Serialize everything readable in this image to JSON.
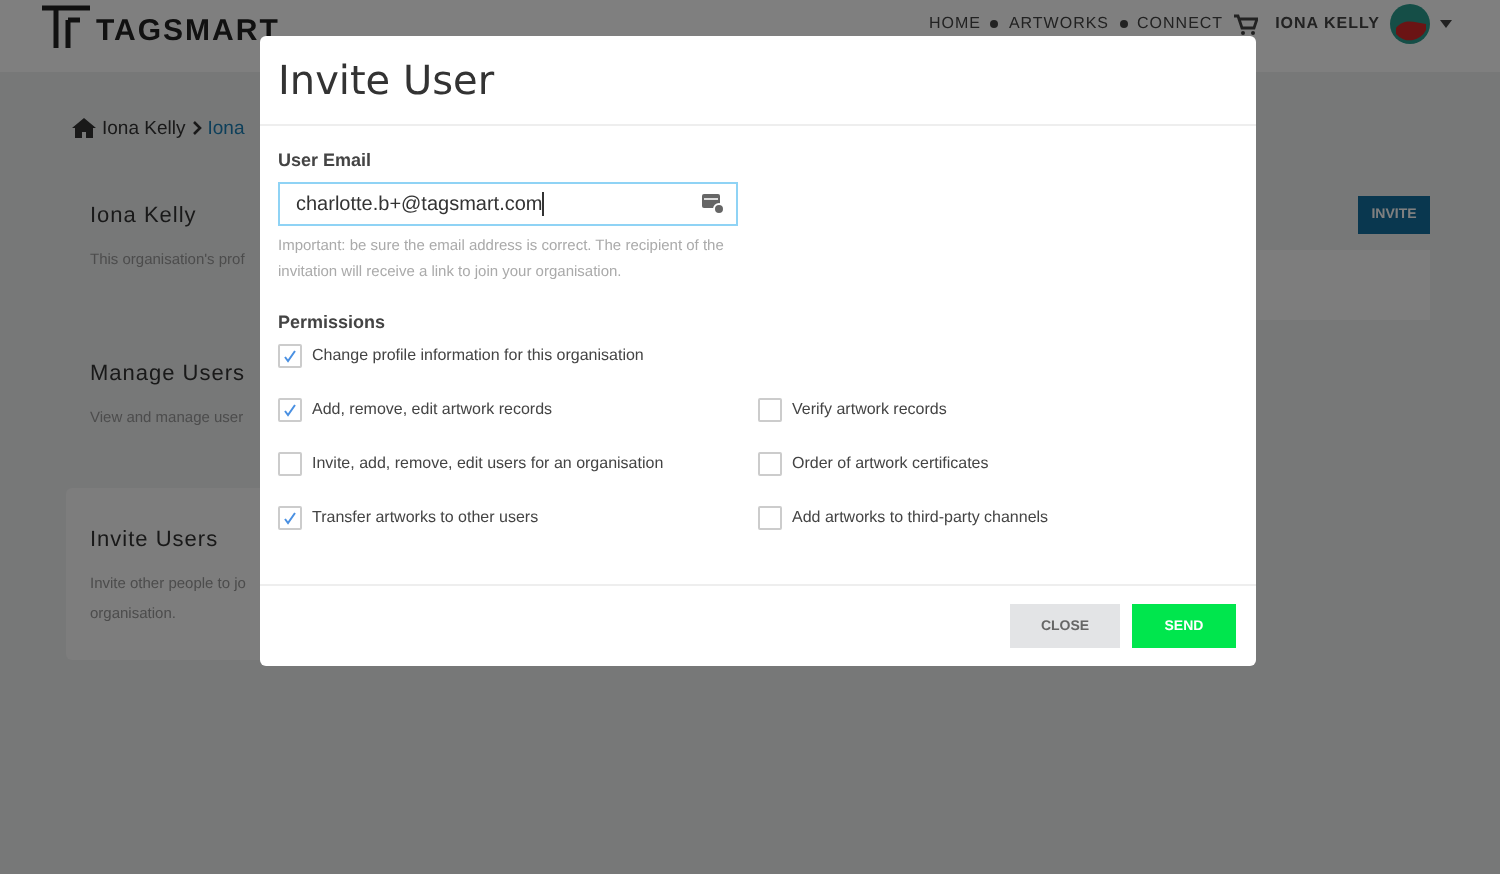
{
  "header": {
    "logo": "TAGSMART",
    "nav": [
      "HOME",
      "ARTWORKS",
      "CONNECT"
    ],
    "user": "IONA KELLY"
  },
  "breadcrumb": [
    "Iona Kelly",
    "Iona"
  ],
  "sections": [
    {
      "title": "Iona Kelly",
      "description": [
        "This organisation's prof"
      ],
      "selected": false
    },
    {
      "title": "Manage Users",
      "description": [
        "View and manage user"
      ],
      "selected": false
    },
    {
      "title": "Invite Users",
      "description": [
        "Invite other people to jo",
        "organisation."
      ],
      "selected": true
    }
  ],
  "invite_button": "INVITE",
  "modal": {
    "title": "Invite User",
    "email": {
      "label": "User Email",
      "value": "charlotte.b+@tagsmart.com"
    },
    "hint": "Important: be sure the email address is correct. The recipient of the invitation will receive a link to join your organisation.",
    "permissions": {
      "label": "Permissions",
      "rows": [
        [
          {
            "label": "Change profile information for this organisation",
            "checked": true
          }
        ],
        [
          {
            "label": "Add, remove, edit artwork records",
            "checked": true
          },
          {
            "label": "Verify artwork records",
            "checked": false
          }
        ],
        [
          {
            "label": "Invite, add, remove, edit users for an organisation",
            "checked": false
          },
          {
            "label": "Order of artwork certificates",
            "checked": false
          }
        ],
        [
          {
            "label": "Transfer artworks to other users",
            "checked": true
          },
          {
            "label": "Add artworks to third-party channels",
            "checked": false
          }
        ]
      ]
    },
    "buttons": {
      "close": "CLOSE",
      "send": "SEND"
    }
  }
}
